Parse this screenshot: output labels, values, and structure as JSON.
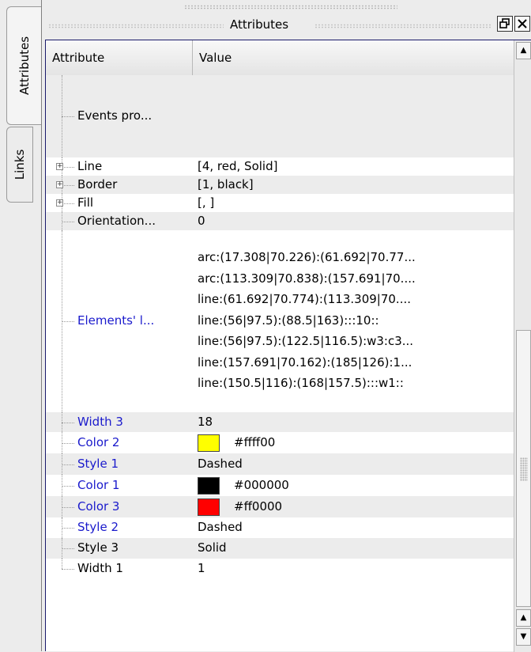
{
  "side_tabs": {
    "attributes": "Attributes",
    "links": "Links"
  },
  "dock": {
    "title": "Attributes",
    "float_glyph": "🗗",
    "close_glyph": "✕"
  },
  "table": {
    "headers": {
      "attribute": "Attribute",
      "value": "Value"
    },
    "rows": [
      {
        "name": "Events pro...",
        "value": "",
        "expandable": false,
        "highlight": false
      },
      {
        "name": "Line",
        "value": "[4, red, Solid]",
        "expandable": true,
        "highlight": false
      },
      {
        "name": "Border",
        "value": "[1, black]",
        "expandable": true,
        "highlight": false
      },
      {
        "name": "Fill",
        "value": "[, ]",
        "expandable": true,
        "highlight": false
      },
      {
        "name": "Orientation...",
        "value": "0",
        "expandable": false,
        "highlight": false
      },
      {
        "name": "Elements' l...",
        "highlight": true,
        "values": [
          "arc:(17.308|70.226):(61.692|70.77...",
          "arc:(113.309|70.838):(157.691|70....",
          "line:(61.692|70.774):(113.309|70....",
          "line:(56|97.5):(88.5|163):::10::",
          "line:(56|97.5):(122.5|116.5):w3:c3...",
          "line:(157.691|70.162):(185|126):1...",
          "line:(150.5|116):(168|157.5):::w1::"
        ]
      },
      {
        "name": "Width 3",
        "value": "18",
        "highlight": true
      },
      {
        "name": "Color 2",
        "value": "#ffff00",
        "swatch": "#ffff00",
        "highlight": true
      },
      {
        "name": "Style 1",
        "value": "Dashed",
        "highlight": true
      },
      {
        "name": "Color 1",
        "value": "#000000",
        "swatch": "#000000",
        "highlight": true
      },
      {
        "name": "Color 3",
        "value": "#ff0000",
        "swatch": "#ff0000",
        "highlight": true
      },
      {
        "name": "Style 2",
        "value": "Dashed",
        "highlight": true
      },
      {
        "name": "Style 3",
        "value": "Solid",
        "highlight": false
      },
      {
        "name": "Width 1",
        "value": "1",
        "highlight": false
      }
    ]
  },
  "colors": {
    "link_blue": "#1a1acc",
    "panel_border": "#1a1a6a"
  }
}
